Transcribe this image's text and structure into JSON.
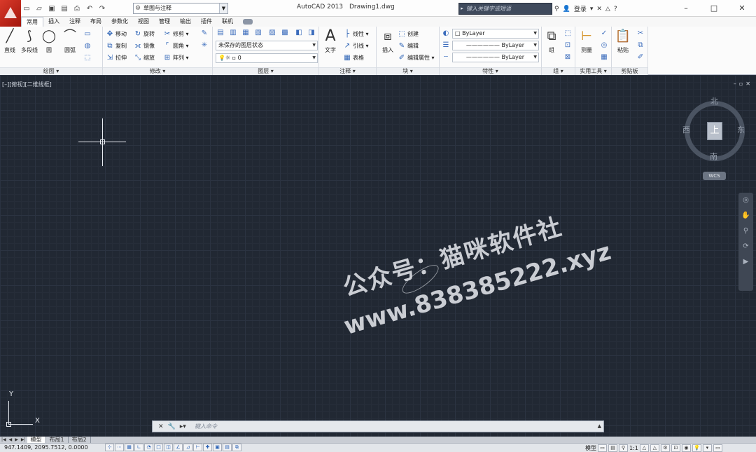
{
  "titlebar": {
    "workspace": "草图与注释",
    "app_title": "AutoCAD 2013",
    "doc_title": "Drawing1.dwg",
    "search_placeholder": "键入关键字或短语",
    "signin": "登录",
    "help": "?"
  },
  "ribbon_tabs": [
    "常用",
    "插入",
    "注释",
    "布局",
    "参数化",
    "视图",
    "管理",
    "输出",
    "插件",
    "联机"
  ],
  "panels": {
    "draw": {
      "title": "绘图",
      "line": "直线",
      "polyline": "多段线",
      "circle": "圆",
      "arc": "圆弧"
    },
    "modify": {
      "title": "修改",
      "move": "移动",
      "rotate": "旋转",
      "trim": "修剪",
      "copy": "复制",
      "mirror": "镜像",
      "fillet": "圆角",
      "stretch": "拉伸",
      "scale": "缩放",
      "array": "阵列"
    },
    "layers": {
      "title": "图层",
      "state": "未保存的图层状态",
      "current_layer": "0"
    },
    "annotation": {
      "title": "注释",
      "text": "文字",
      "dimension": "线性",
      "leader": "引线",
      "table": "表格"
    },
    "block": {
      "title": "块",
      "insert": "插入",
      "create": "创建",
      "edit": "编辑",
      "edit_attr": "编辑属性"
    },
    "properties": {
      "title": "特性",
      "color": "ByLayer",
      "linetype": "ByLayer",
      "lineweight": "ByLayer"
    },
    "groups": {
      "title": "组",
      "group": "组"
    },
    "utilities": {
      "title": "实用工具",
      "measure": "测量"
    },
    "clipboard": {
      "title": "剪贴板",
      "paste": "粘贴"
    }
  },
  "viewport": {
    "label": "[–][俯视][二维线框]",
    "controls": [
      "–",
      "▫",
      "✕"
    ]
  },
  "viewcube": {
    "north": "北",
    "south": "南",
    "east": "东",
    "west": "西",
    "face": "上",
    "wcs": "WCS"
  },
  "ucs": {
    "x": "X",
    "y": "Y"
  },
  "watermark": {
    "line1": "公众号：猫咪软件社",
    "line2": "www.838385222.xyz"
  },
  "command": {
    "placeholder": "键入命令"
  },
  "layout_tabs": [
    "模型",
    "布局1",
    "布局2"
  ],
  "status": {
    "coords": "947.1409,  2095.7512,  0.0000",
    "model": "模型",
    "scale": "1:1"
  }
}
